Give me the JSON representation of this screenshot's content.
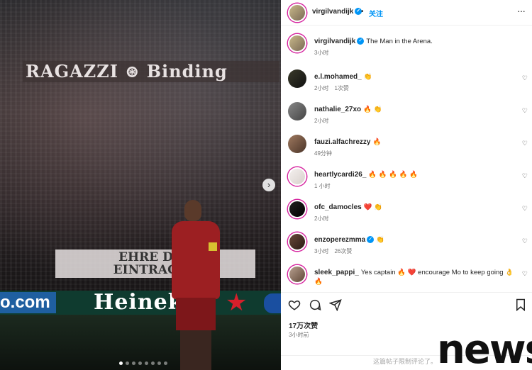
{
  "photo": {
    "banner_top": "RAGAZZI ⊛ Binding",
    "banner_bottom_line1": "EHRE DER",
    "banner_bottom_line2": "EINTRACHT",
    "ad_left": "o.com",
    "ad_main": "Heineken",
    "carousel_dots": 8,
    "carousel_active_index": 0
  },
  "header": {
    "username": "virgilvandijk",
    "follow_label": "关注",
    "more_label": "···"
  },
  "comments": [
    {
      "username": "virgilvandijk",
      "verified": true,
      "text": "The Man in the Arena.",
      "time": "3小时",
      "likes": "",
      "heart": false
    },
    {
      "username": "e.l.mohamed_",
      "verified": false,
      "text": "👏",
      "time": "2小时",
      "likes": "1次赞",
      "heart": true
    },
    {
      "username": "nathalie_27xo",
      "verified": false,
      "text": "🔥 👏",
      "time": "2小时",
      "likes": "",
      "heart": true
    },
    {
      "username": "fauzi.alfachrezzy",
      "verified": false,
      "text": "🔥",
      "time": "49分钟",
      "likes": "",
      "heart": true
    },
    {
      "username": "heartlycardi26_",
      "verified": false,
      "text": "🔥 🔥 🔥 🔥 🔥",
      "time": "1 小时",
      "likes": "",
      "heart": true
    },
    {
      "username": "ofc_damocles",
      "verified": false,
      "text": "❤️ 👏",
      "time": "2小时",
      "likes": "",
      "heart": true
    },
    {
      "username": "enzoperezmma",
      "verified": true,
      "text": "👏",
      "time": "3小时",
      "likes": "26次赞",
      "heart": true
    },
    {
      "username": "sleek_pappi_",
      "verified": false,
      "text": "Yes captain 🔥 ❤️ encourage Mo to keep going 👌 🔥",
      "time": "",
      "likes": "",
      "heart": true
    }
  ],
  "actions": {
    "likes": "17万次赞",
    "posted": "3小时前",
    "comments_limited": "这篇帖子限制评论了。"
  },
  "watermark": "news",
  "colors": {
    "accent_blue": "#0095f6",
    "text": "#262626",
    "muted": "#737373"
  }
}
